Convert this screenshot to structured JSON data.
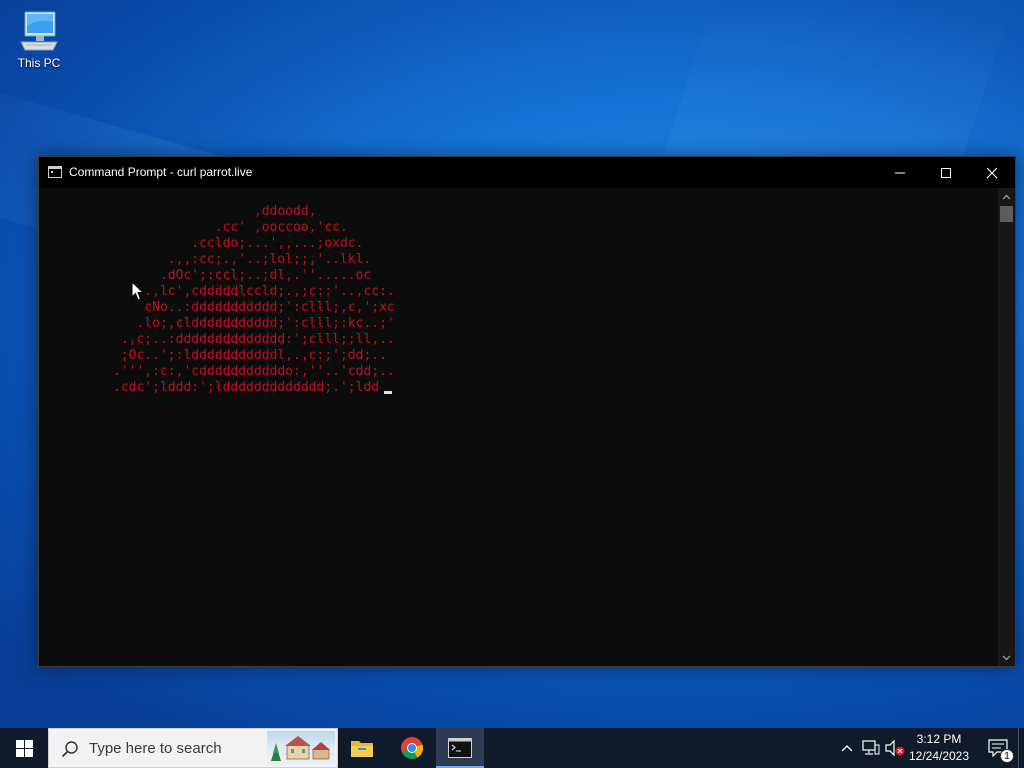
{
  "desktop": {
    "icons": [
      {
        "label": "This PC",
        "icon": "this-pc-icon"
      }
    ]
  },
  "window": {
    "title": "Command Prompt - curl  parrot.live",
    "controls": [
      "minimize",
      "maximize",
      "close"
    ],
    "console": {
      "text_color": "#c50f1f",
      "background": "#0c0c0c",
      "lines": [
        "                  ,ddoodd,",
        "             .cc' ,ooccoo,'cc.",
        "          .ccldo;...',,...;oxdc.",
        "       .,,:cc;.,'..;lol;;,'..lkl.",
        "      .dOc';:ccl;..;dl,.''.....oc",
        "    .,lc',cdddddlccld;.,;c::'..,cc:.",
        "    cNo..:ddddddddddd;':clll;,c,';xc",
        "   .lo;,clddddddddddd;':clll;:kc..;'",
        " .,c;..:dddddddddddddd:';clll;;ll,..",
        " ;Oc..';:ldddddddddddl,.,c:;';dd;..",
        ".''',:c:,'cdddddddddddo:,''..'cdd;..",
        ".cdc';lddd:';lddddddddddddd;.';ldd"
      ]
    }
  },
  "taskbar": {
    "search_placeholder": "Type here to search",
    "apps": [
      {
        "name": "file-explorer",
        "icon": "folder-icon"
      },
      {
        "name": "google-chrome",
        "icon": "chrome-icon"
      },
      {
        "name": "command-prompt",
        "icon": "console-icon",
        "active": true
      }
    ],
    "tray": {
      "icons": [
        "chevron-up-icon",
        "network-icon",
        "volume-muted-icon"
      ],
      "time": "3:12 PM",
      "date": "12/24/2023",
      "notification_count": "1"
    }
  }
}
